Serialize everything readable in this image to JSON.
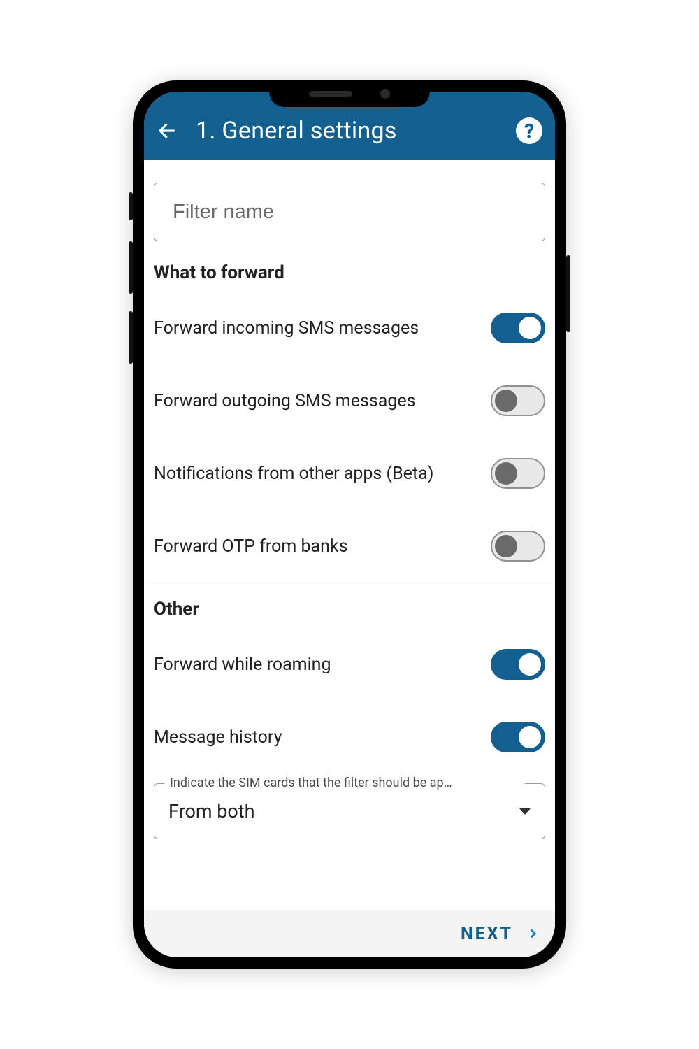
{
  "header": {
    "title": "1. General settings"
  },
  "filter": {
    "placeholder": "Filter name",
    "value": ""
  },
  "sections": {
    "what_to_forward": {
      "title": "What to forward",
      "items": [
        {
          "label": "Forward incoming SMS messages",
          "on": true
        },
        {
          "label": "Forward outgoing SMS messages",
          "on": false
        },
        {
          "label": "Notifications from other apps (Beta)",
          "on": false
        },
        {
          "label": "Forward OTP from banks",
          "on": false
        }
      ]
    },
    "other": {
      "title": "Other",
      "items": [
        {
          "label": "Forward while roaming",
          "on": true
        },
        {
          "label": "Message history",
          "on": true
        }
      ]
    }
  },
  "sim_select": {
    "legend": "Indicate the SIM cards that the filter should be ap…",
    "value": "From both"
  },
  "footer": {
    "next": "NEXT"
  },
  "colors": {
    "primary": "#136090"
  }
}
